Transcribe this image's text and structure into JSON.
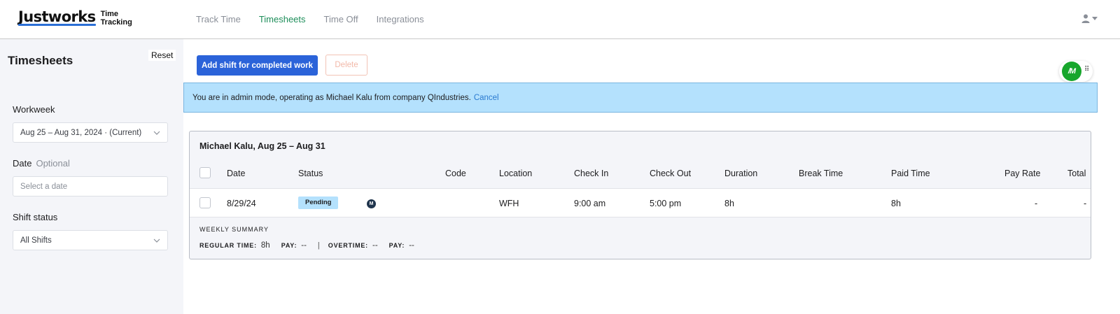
{
  "brand": {
    "name": "Justworks",
    "sub1": "Time",
    "sub2": "Tracking"
  },
  "nav": {
    "items": [
      "Track Time",
      "Timesheets",
      "Time Off",
      "Integrations"
    ],
    "active_index": 1
  },
  "sidebar": {
    "title": "Timesheets",
    "reset_label": "Reset",
    "workweek_label": "Workweek",
    "workweek_value": "Aug 25 – Aug 31, 2024 · (Current)",
    "date_label": "Date",
    "date_optional": "Optional",
    "date_placeholder": "Select a date",
    "shift_status_label": "Shift status",
    "shift_status_value": "All Shifts"
  },
  "toolbar": {
    "add_shift_label": "Add shift for completed work",
    "delete_label": "Delete"
  },
  "banner": {
    "text": "You are in admin mode, operating as Michael Kalu from company QIndustries.",
    "cancel_label": "Cancel"
  },
  "widget": {
    "logo_text": "/M"
  },
  "card": {
    "title": "Michael Kalu, Aug 25 – Aug 31",
    "columns": [
      "Date",
      "Status",
      "Code",
      "Location",
      "Check In",
      "Check Out",
      "Duration",
      "Break Time",
      "Paid Time",
      "Pay Rate",
      "Total"
    ],
    "rows": [
      {
        "date": "8/29/24",
        "status": "Pending",
        "avatar": "M",
        "code": "",
        "location": "WFH",
        "check_in": "9:00 am",
        "check_out": "5:00 pm",
        "duration": "8h",
        "break_time": "",
        "paid_time": "8h",
        "pay_rate": "-",
        "total": "-"
      }
    ],
    "summary": {
      "title": "WEEKLY SUMMARY",
      "regular_time_label": "REGULAR TIME:",
      "regular_time_value": "8h",
      "pay_label": "PAY:",
      "pay_value": "--",
      "separator": "|",
      "overtime_label": "OVERTIME:",
      "overtime_value": "--",
      "pay2_label": "PAY:",
      "pay2_value": "--"
    }
  },
  "colors": {
    "primary": "#2b63d9",
    "active_nav": "#1e8e5a",
    "banner_bg": "#b4e1fd",
    "sidebar_bg": "#f4f5f9"
  }
}
